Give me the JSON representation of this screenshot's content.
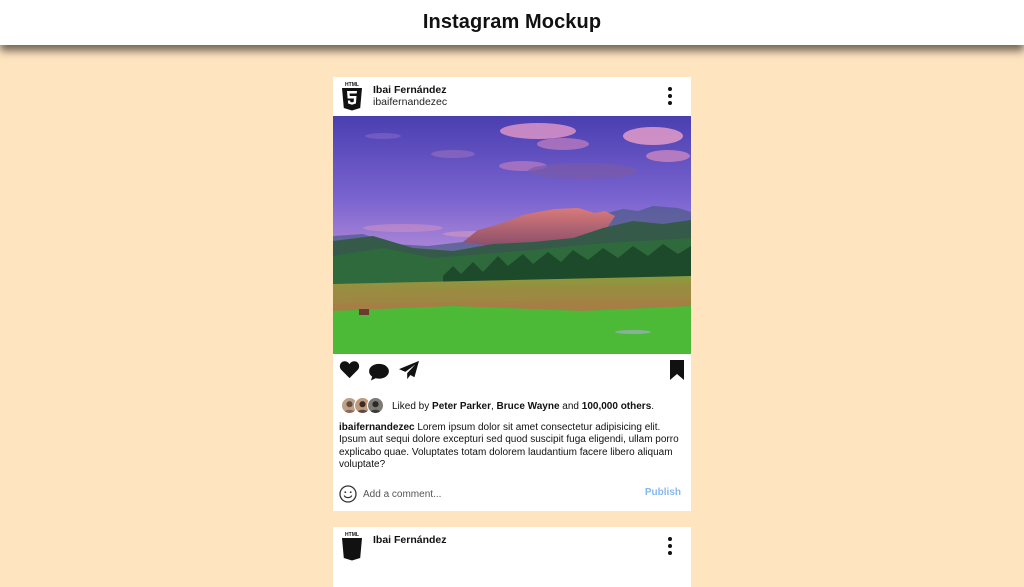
{
  "app": {
    "title": "Instagram Mockup"
  },
  "post": {
    "author_name": "Ibai Fernández",
    "author_handle": "ibaifernandezec",
    "logo_text": "HTML",
    "liked_prefix": "Liked by ",
    "liked_user_1": "Peter Parker",
    "liked_sep": ", ",
    "liked_user_2": "Bruce Wayne",
    "liked_and": " and ",
    "liked_others": "100,000 others",
    "liked_end": ".",
    "caption_user": "ibaifernandezec",
    "caption_text": " Lorem ipsum dolor sit amet consectetur adipisicing elit. Ipsum aut sequi dolore excepturi sed quod suscipit fuga eligendi, ullam porro explicabo quae. Voluptates totam dolorem laudantium facere libero aliquam voluptate?",
    "comment_placeholder": "Add a comment...",
    "publish_label": "Publish"
  },
  "next_post": {
    "author_name": "Ibai Fernández",
    "logo_text": "HTML"
  },
  "icons": {
    "logo": "html5-icon",
    "more": "more-vertical-icon",
    "like": "heart-icon",
    "comment": "comment-icon",
    "share": "paper-plane-icon",
    "save": "bookmark-icon",
    "emoji": "smile-icon"
  },
  "colors": {
    "background": "#ffe4c0",
    "publish": "#86b8f0"
  }
}
